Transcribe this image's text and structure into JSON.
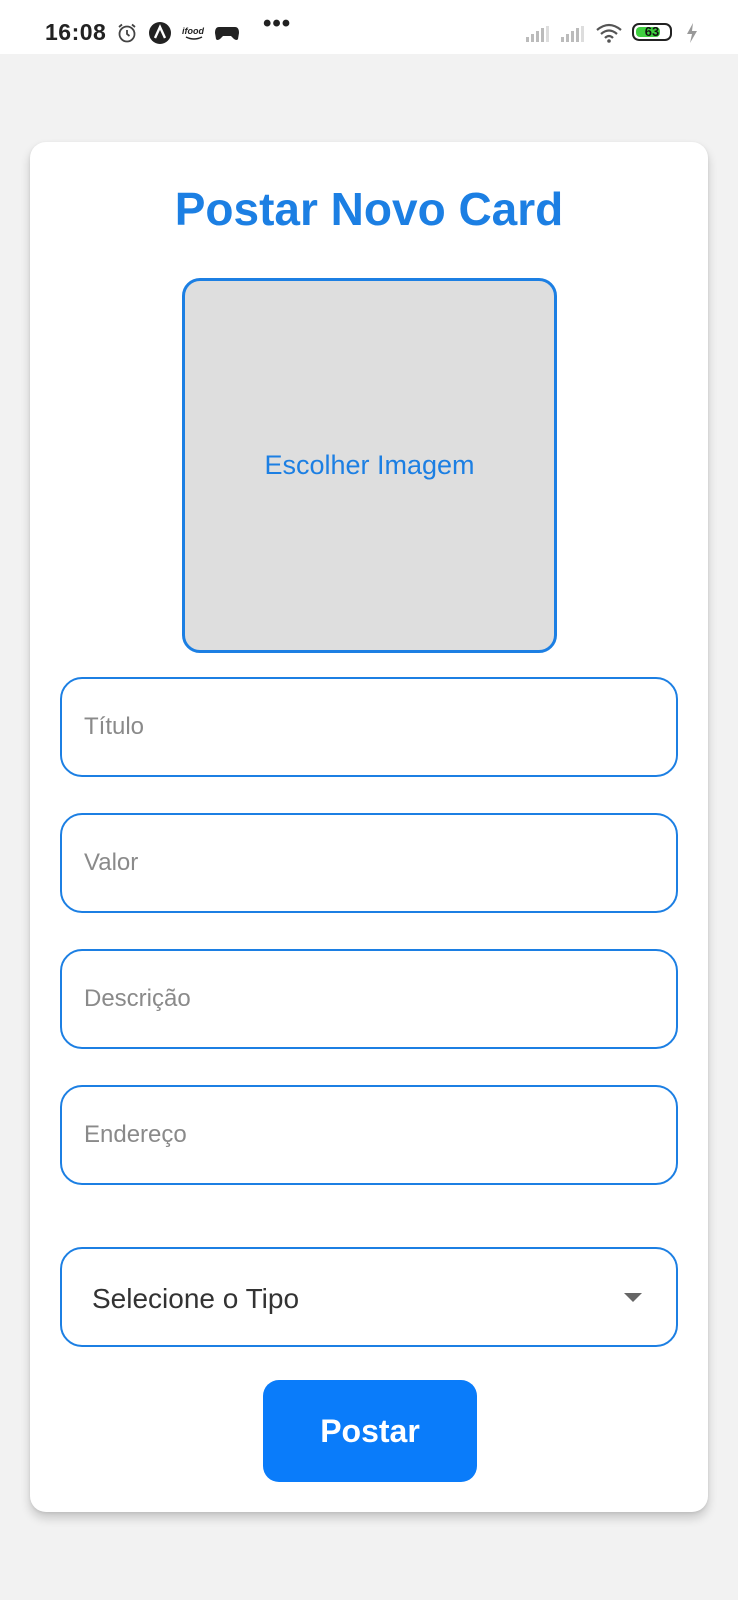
{
  "status_bar": {
    "time": "16:08",
    "battery_level": "63",
    "icons": [
      "alarm-icon",
      "app-a-icon",
      "ifood-icon",
      "gamepad-icon",
      "more-dots-icon",
      "signal-icon",
      "signal-icon",
      "wifi-icon",
      "battery-icon",
      "charging-icon"
    ]
  },
  "form": {
    "title": "Postar Novo Card",
    "image_button_label": "Escolher Imagem",
    "fields": {
      "titulo_placeholder": "Título",
      "valor_placeholder": "Valor",
      "descricao_placeholder": "Descrição",
      "endereco_placeholder": "Endereço"
    },
    "type_select": {
      "selected": "Selecione o Tipo"
    },
    "submit_label": "Postar"
  },
  "colors": {
    "accent": "#1c7fe3",
    "button": "#0a7cfa",
    "image_placeholder_bg": "#dedede",
    "page_bg": "#f2f2f2"
  }
}
